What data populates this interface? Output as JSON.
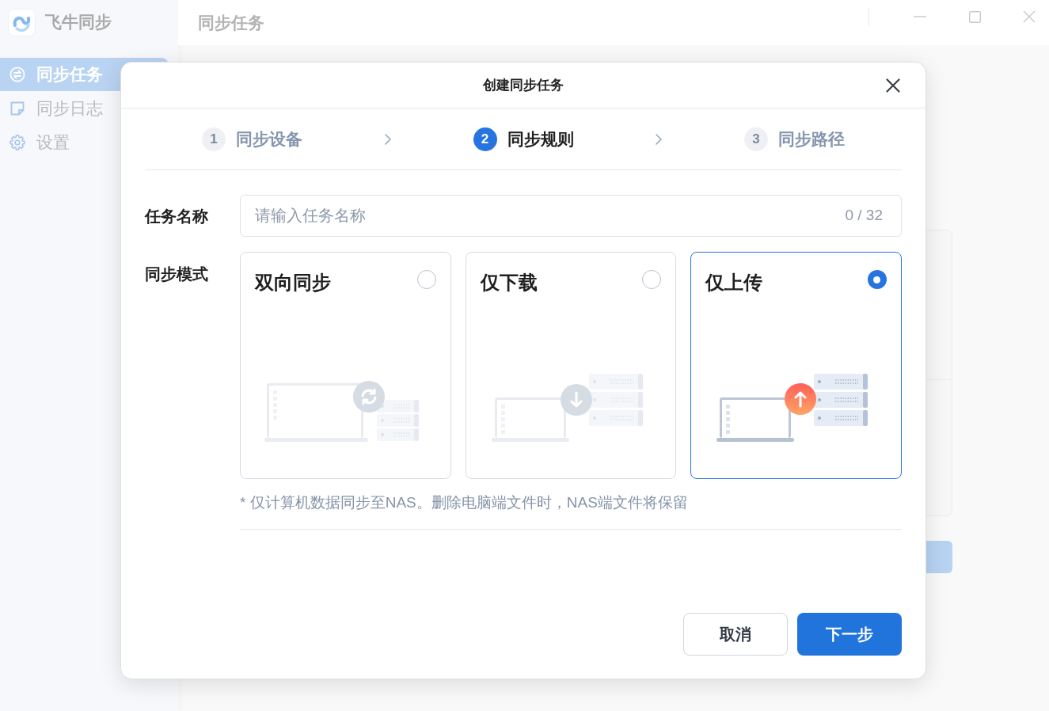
{
  "app": {
    "name": "飞牛同步"
  },
  "sidebar": {
    "items": [
      {
        "label": "同步任务",
        "selected": true
      },
      {
        "label": "同步日志",
        "selected": false
      },
      {
        "label": "设置",
        "selected": false
      }
    ]
  },
  "header": {
    "title": "同步任务"
  },
  "dialog": {
    "title": "创建同步任务",
    "steps": [
      {
        "number": "1",
        "label": "同步设备",
        "selected": false
      },
      {
        "number": "2",
        "label": "同步规则",
        "selected": true
      },
      {
        "number": "3",
        "label": "同步路径",
        "selected": false
      }
    ],
    "task_name": {
      "label": "任务名称",
      "placeholder": "请输入任务名称",
      "counter": "0 / 32"
    },
    "sync_mode": {
      "label": "同步模式",
      "options": [
        {
          "kind": "two_way",
          "label": "双向同步",
          "selected": false
        },
        {
          "kind": "download",
          "label": "仅下载",
          "selected": false
        },
        {
          "kind": "upload",
          "label": "仅上传",
          "selected": true
        }
      ],
      "note": "* 仅计算机数据同步至NAS。删除电脑端文件时，NAS端文件将保留"
    },
    "buttons": [
      {
        "kind": "secondary",
        "label": "取消"
      },
      {
        "kind": "primary",
        "label": "下一步"
      }
    ]
  }
}
